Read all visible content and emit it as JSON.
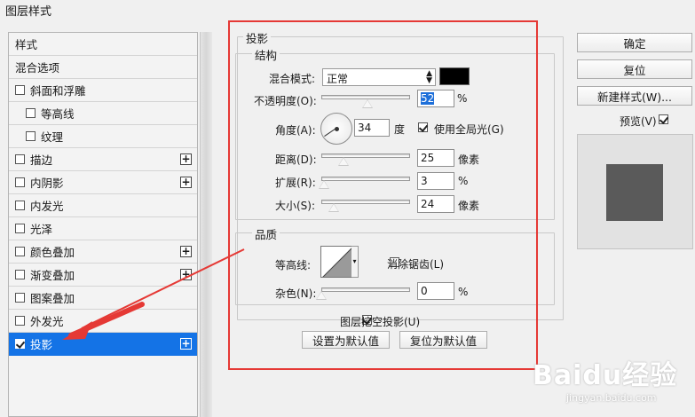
{
  "window": {
    "title": "图层样式"
  },
  "left_list": {
    "items": [
      {
        "label": "样式",
        "checkbox": false,
        "checked": false,
        "plus": false,
        "indent": false,
        "selected": false
      },
      {
        "label": "混合选项",
        "checkbox": false,
        "checked": false,
        "plus": false,
        "indent": false,
        "selected": false
      },
      {
        "label": "斜面和浮雕",
        "checkbox": true,
        "checked": false,
        "plus": false,
        "indent": false,
        "selected": false
      },
      {
        "label": "等高线",
        "checkbox": true,
        "checked": false,
        "plus": false,
        "indent": true,
        "selected": false
      },
      {
        "label": "纹理",
        "checkbox": true,
        "checked": false,
        "plus": false,
        "indent": true,
        "selected": false
      },
      {
        "label": "描边",
        "checkbox": true,
        "checked": false,
        "plus": true,
        "indent": false,
        "selected": false
      },
      {
        "label": "内阴影",
        "checkbox": true,
        "checked": false,
        "plus": true,
        "indent": false,
        "selected": false
      },
      {
        "label": "内发光",
        "checkbox": true,
        "checked": false,
        "plus": false,
        "indent": false,
        "selected": false
      },
      {
        "label": "光泽",
        "checkbox": true,
        "checked": false,
        "plus": false,
        "indent": false,
        "selected": false
      },
      {
        "label": "颜色叠加",
        "checkbox": true,
        "checked": false,
        "plus": true,
        "indent": false,
        "selected": false
      },
      {
        "label": "渐变叠加",
        "checkbox": true,
        "checked": false,
        "plus": true,
        "indent": false,
        "selected": false
      },
      {
        "label": "图案叠加",
        "checkbox": true,
        "checked": false,
        "plus": false,
        "indent": false,
        "selected": false
      },
      {
        "label": "外发光",
        "checkbox": true,
        "checked": false,
        "plus": false,
        "indent": false,
        "selected": false
      },
      {
        "label": "投影",
        "checkbox": true,
        "checked": true,
        "plus": true,
        "indent": false,
        "selected": true
      }
    ]
  },
  "drop_shadow": {
    "section_title": "投影",
    "structure_title": "结构",
    "blend_mode_label": "混合模式:",
    "blend_mode_value": "正常",
    "shadow_color": "#000000",
    "opacity_label": "不透明度(O):",
    "opacity_value": "52",
    "opacity_unit": "%",
    "opacity_fraction": 0.52,
    "angle_label": "角度(A):",
    "angle_value": "34",
    "angle_unit": "度",
    "global_light_label": "使用全局光(G)",
    "global_light_checked": true,
    "distance_label": "距离(D):",
    "distance_value": "25",
    "distance_unit": "像素",
    "distance_fraction": 0.25,
    "spread_label": "扩展(R):",
    "spread_value": "3",
    "spread_unit": "%",
    "spread_fraction": 0.03,
    "size_label": "大小(S):",
    "size_value": "24",
    "size_unit": "像素",
    "size_fraction": 0.14,
    "quality_title": "品质",
    "contour_label": "等高线:",
    "anti_alias_label": "消除锯齿(L)",
    "anti_alias_checked": false,
    "noise_label": "杂色(N):",
    "noise_value": "0",
    "noise_unit": "%",
    "noise_fraction": 0.0,
    "knockout_label": "图层挖空投影(U)",
    "knockout_checked": true,
    "make_default_label": "设置为默认值",
    "reset_default_label": "复位为默认值"
  },
  "right_buttons": {
    "ok_label": "确定",
    "reset_label": "复位",
    "new_style_label": "新建样式(W)...",
    "preview_label": "预览(V)",
    "preview_checked": true
  },
  "colors": {
    "selection_blue": "#1473e6",
    "highlight_red": "#e53935",
    "preview_swatch": "#5a5a5a"
  },
  "watermark": {
    "brand": "Baidu经验",
    "url": "jingyan.baidu.com"
  }
}
